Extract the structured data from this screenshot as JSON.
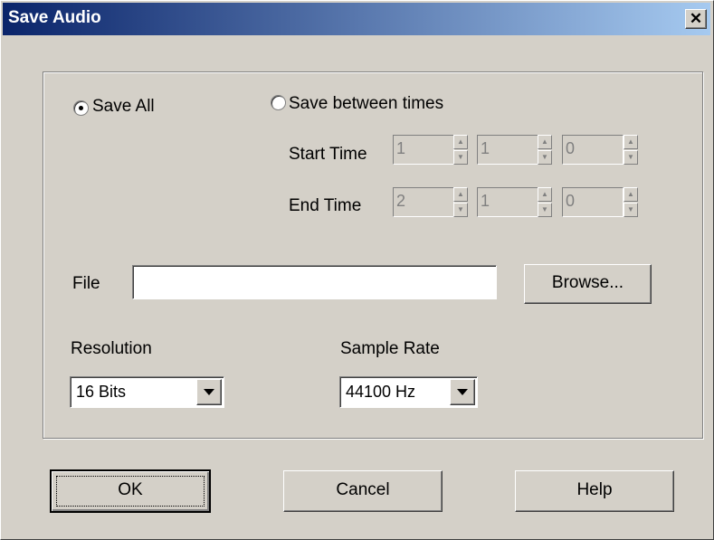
{
  "window": {
    "title": "Save Audio",
    "close_glyph": "✕"
  },
  "range": {
    "save_all_label": "Save All",
    "save_all_selected": true,
    "save_between_label": "Save between times",
    "save_between_selected": false,
    "start_time_label": "Start Time",
    "end_time_label": "End Time",
    "start_values": [
      "1",
      "1",
      "0"
    ],
    "end_values": [
      "2",
      "1",
      "0"
    ]
  },
  "file": {
    "label": "File",
    "value": "",
    "browse_label": "Browse..."
  },
  "resolution": {
    "label": "Resolution",
    "selected": "16 Bits"
  },
  "sample_rate": {
    "label": "Sample Rate",
    "selected": "44100 Hz"
  },
  "buttons": {
    "ok": "OK",
    "cancel": "Cancel",
    "help": "Help"
  },
  "icons": {
    "close": "close-icon",
    "radio": "radio-button-icon",
    "spin_up": "spin-up-arrow-icon",
    "spin_down": "spin-down-arrow-icon",
    "dropdown": "dropdown-arrow-icon"
  },
  "colors": {
    "title_start": "#0a246a",
    "title_end": "#a6caf0",
    "face": "#d4d0c8",
    "disabled_text": "#808080"
  }
}
